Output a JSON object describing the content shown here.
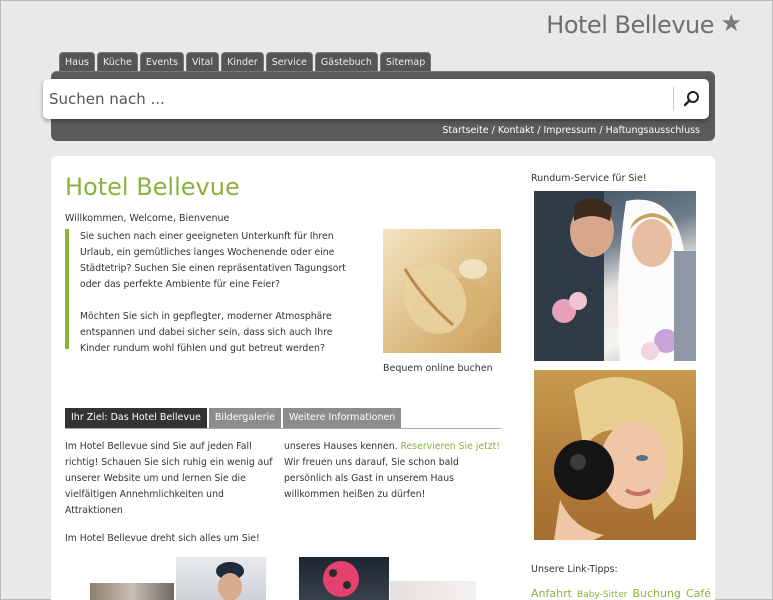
{
  "site": {
    "brand": "Hotel Bellevue",
    "star_icon": "star-icon"
  },
  "nav": {
    "tabs": [
      "Haus",
      "Küche",
      "Events",
      "Vital",
      "Kinder",
      "Service",
      "Gästebuch",
      "Sitemap"
    ],
    "search_placeholder": "Suchen nach ...",
    "search_icon": "search-icon",
    "util_links": [
      "Startseite",
      "Kontakt",
      "Impressum",
      "Haftungsausschluss"
    ],
    "util_separator": " / "
  },
  "main": {
    "title": "Hotel Bellevue",
    "subtitle": "Willkommen, Welcome, Bienvenue",
    "intro_p1": "Sie suchen nach einer geeigneten Unterkunft für Ihren Urlaub, ein gemütliches langes Wochenende oder eine Städtetrip? Suchen Sie einen repräsentativen Tagungsort oder das perfekte Ambiente für eine Feier?",
    "intro_p2": "Möchten Sie sich in gepflegter, moderner Atmosphäre entspannen und dabei sicher sein, dass sich auch Ihre Kinder rundum wohl fühlen und gut betreut werden?",
    "image_caption": "Bequem online buchen",
    "content_tabs": [
      "Ihr Ziel: Das Hotel Bellevue",
      "Bildergalerie",
      "Weitere Informationen"
    ],
    "col1_p1": "Im Hotel Bellevue sind Sie auf jeden Fall richtig! Schauen Sie sich ruhig ein wenig auf unserer Website um und lernen Sie die vielfältigen Annehmlichkeiten und Attraktionen",
    "col1_p2": "Im Hotel Bellevue dreht sich alles um Sie!",
    "col2_pre": "unseres Hauses kennen. ",
    "col2_link": "Reservieren Sie jetzt!",
    "col2_post": " Wir freuen uns darauf, Sie schon bald persönlich als Gast in unserem Haus willkommen heißen zu dürfen!"
  },
  "sidebar": {
    "title": "Rundum-Service für Sie!",
    "link_tips_title": "Unsere Link-Tipps:",
    "link_tips": [
      {
        "label": "Anfahrt",
        "size": "big"
      },
      {
        "label": "Baby-Sitter",
        "size": "small"
      },
      {
        "label": "Buchung",
        "size": "big"
      },
      {
        "label": "Café",
        "size": "big"
      }
    ]
  },
  "colors": {
    "accent_green": "#8bb23e",
    "nav_dark": "#5b5b5b",
    "tab_active": "#333333",
    "tab_inactive": "#8c8c8c"
  }
}
